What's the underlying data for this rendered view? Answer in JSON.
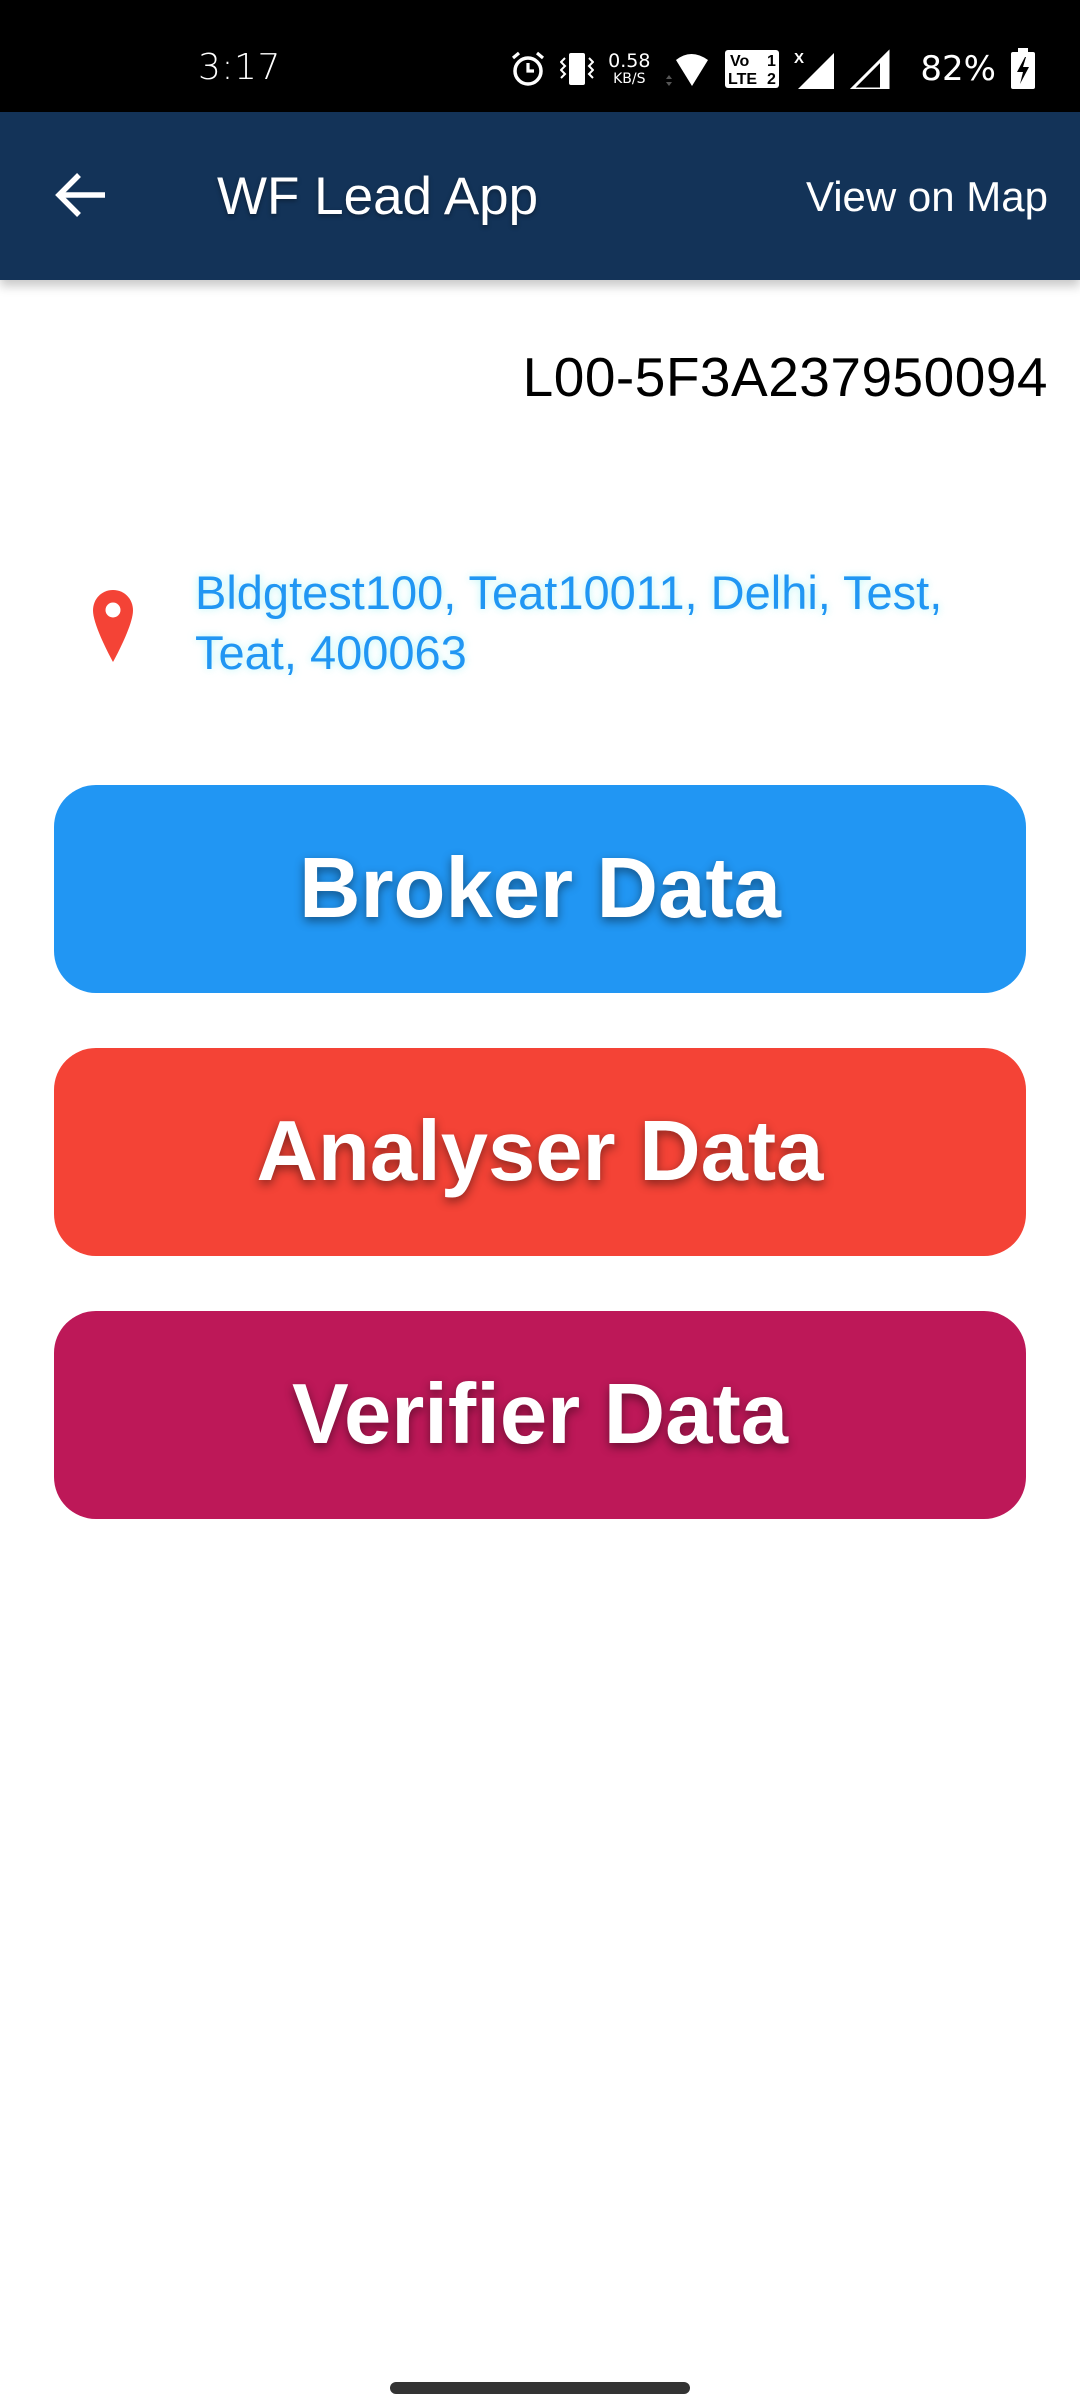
{
  "status_bar": {
    "time": "3:17",
    "net_speed_value": "0.58",
    "net_speed_unit": "KB/S",
    "battery_percent": "82%",
    "icons": [
      "alarm-icon",
      "vibrate-icon",
      "wifi-icon",
      "volte-lte-icon",
      "signal-sim1-icon",
      "signal-sim2-icon",
      "battery-charging-icon"
    ],
    "volte_label_top": "Vo",
    "volte_label_bottom": "LTE",
    "sim1": "1",
    "sim2": "2",
    "no_service_mark": "X"
  },
  "app_bar": {
    "back_icon": "arrow-left-icon",
    "title": "WF Lead App",
    "view_on_map_label": "View on Map",
    "background_color": "#133358"
  },
  "lead": {
    "id": "L00-5F3A237950094",
    "address_icon": "map-pin-icon",
    "address": "Bldgtest100, Teat10011, Delhi, Test, Teat, 400063",
    "address_color": "#2196f3"
  },
  "actions": [
    {
      "label": "Broker Data",
      "color": "#2196f3"
    },
    {
      "label": "Analyser Data",
      "color": "#f44336"
    },
    {
      "label": "Verifier Data",
      "color": "#bd1858"
    }
  ]
}
